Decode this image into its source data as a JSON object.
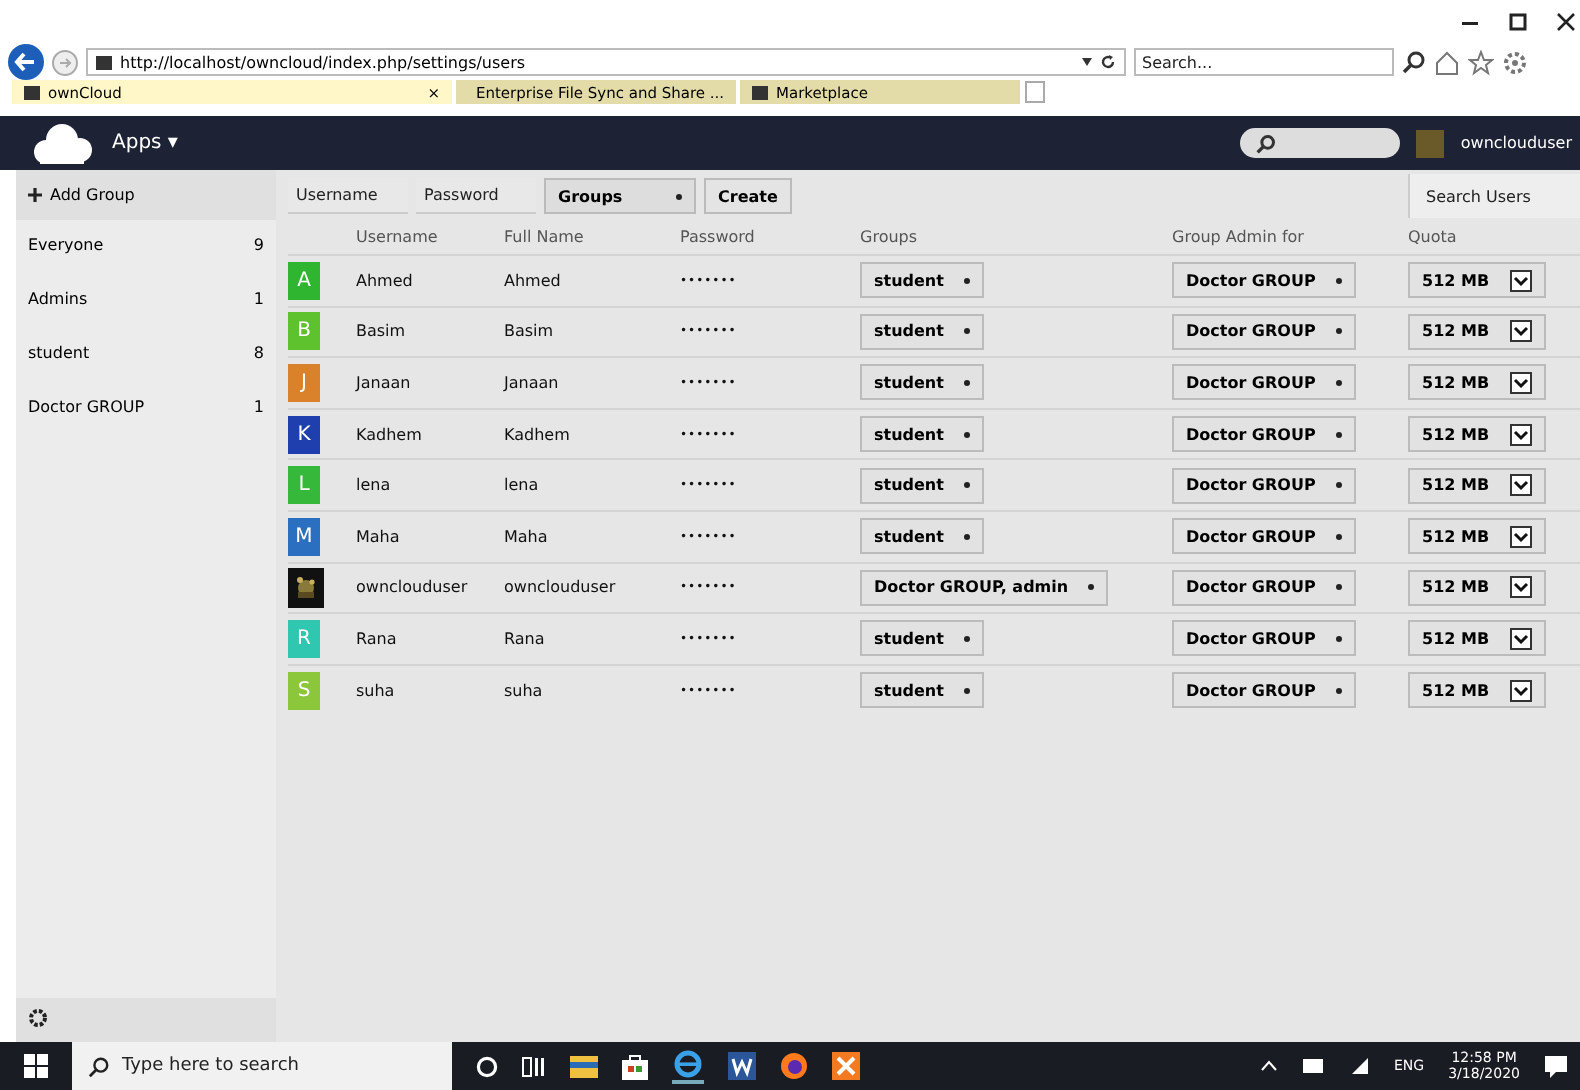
{
  "browser": {
    "url": "http://localhost/owncloud/index.php/settings/users",
    "search_placeholder": "Search...",
    "tabs": [
      {
        "label": "ownCloud",
        "selected": true,
        "close": "×"
      },
      {
        "label": "Enterprise File Sync and Share ...",
        "selected": false
      },
      {
        "label": "Marketplace",
        "selected": false
      }
    ]
  },
  "header": {
    "apps_label": "Apps ▾",
    "user": "ownclouduser"
  },
  "sidebar": {
    "add_group": "Add Group",
    "groups": [
      {
        "name": "Everyone",
        "count": "9"
      },
      {
        "name": "Admins",
        "count": "1"
      },
      {
        "name": "student",
        "count": "8"
      },
      {
        "name": "Doctor GROUP",
        "count": "1"
      }
    ]
  },
  "create_form": {
    "username_placeholder": "Username",
    "password_placeholder": "Password",
    "groups": "Groups",
    "create": "Create",
    "search_placeholder": "Search Users"
  },
  "table": {
    "columns": [
      "Username",
      "Full Name",
      "Password",
      "Groups",
      "Group Admin for",
      "Quota"
    ],
    "rows": [
      {
        "initial": "A",
        "color": "#2fb52f",
        "kind": "letter",
        "username": "Ahmed",
        "full_name": "Ahmed",
        "password": "•••••••",
        "groups": "student",
        "admin_for": "Doctor GROUP",
        "quota": "512 MB"
      },
      {
        "initial": "B",
        "color": "#5ec22e",
        "kind": "letter",
        "username": "Basim",
        "full_name": "Basim",
        "password": "•••••••",
        "groups": "student",
        "admin_for": "Doctor GROUP",
        "quota": "512 MB"
      },
      {
        "initial": "J",
        "color": "#d9822b",
        "kind": "letter",
        "username": "Janaan",
        "full_name": "Janaan",
        "password": "•••••••",
        "groups": "student",
        "admin_for": "Doctor GROUP",
        "quota": "512 MB"
      },
      {
        "initial": "K",
        "color": "#1f3fae",
        "kind": "letter",
        "username": "Kadhem",
        "full_name": "Kadhem",
        "password": "•••••••",
        "groups": "student",
        "admin_for": "Doctor GROUP",
        "quota": "512 MB"
      },
      {
        "initial": "L",
        "color": "#36b83a",
        "kind": "letter",
        "username": "lena",
        "full_name": "lena",
        "password": "•••••••",
        "groups": "student",
        "admin_for": "Doctor GROUP",
        "quota": "512 MB"
      },
      {
        "initial": "M",
        "color": "#2b6fc0",
        "kind": "letter",
        "username": "Maha",
        "full_name": "Maha",
        "password": "•••••••",
        "groups": "student",
        "admin_for": "Doctor GROUP",
        "quota": "512 MB"
      },
      {
        "username": "ownclouduser",
        "full_name": "ownclouduser",
        "password": "•••••••",
        "groups": "Doctor GROUP, admin",
        "admin_for": "Doctor GROUP",
        "quota": "512 MB"
      },
      {
        "initial": "R",
        "color": "#2fc7b0",
        "kind": "letter",
        "username": "Rana",
        "full_name": "Rana",
        "password": "•••••••",
        "groups": "student",
        "admin_for": "Doctor GROUP",
        "quota": "512 MB"
      },
      {
        "initial": "S",
        "color": "#8cc63a",
        "kind": "letter",
        "username": "suha",
        "full_name": "suha",
        "password": "•••••••",
        "groups": "student",
        "admin_for": "Doctor GROUP",
        "quota": "512 MB"
      }
    ]
  },
  "taskbar": {
    "search_placeholder": "Type here to search",
    "language": "ENG",
    "time": "12:58 PM",
    "date": "3/18/2020"
  }
}
